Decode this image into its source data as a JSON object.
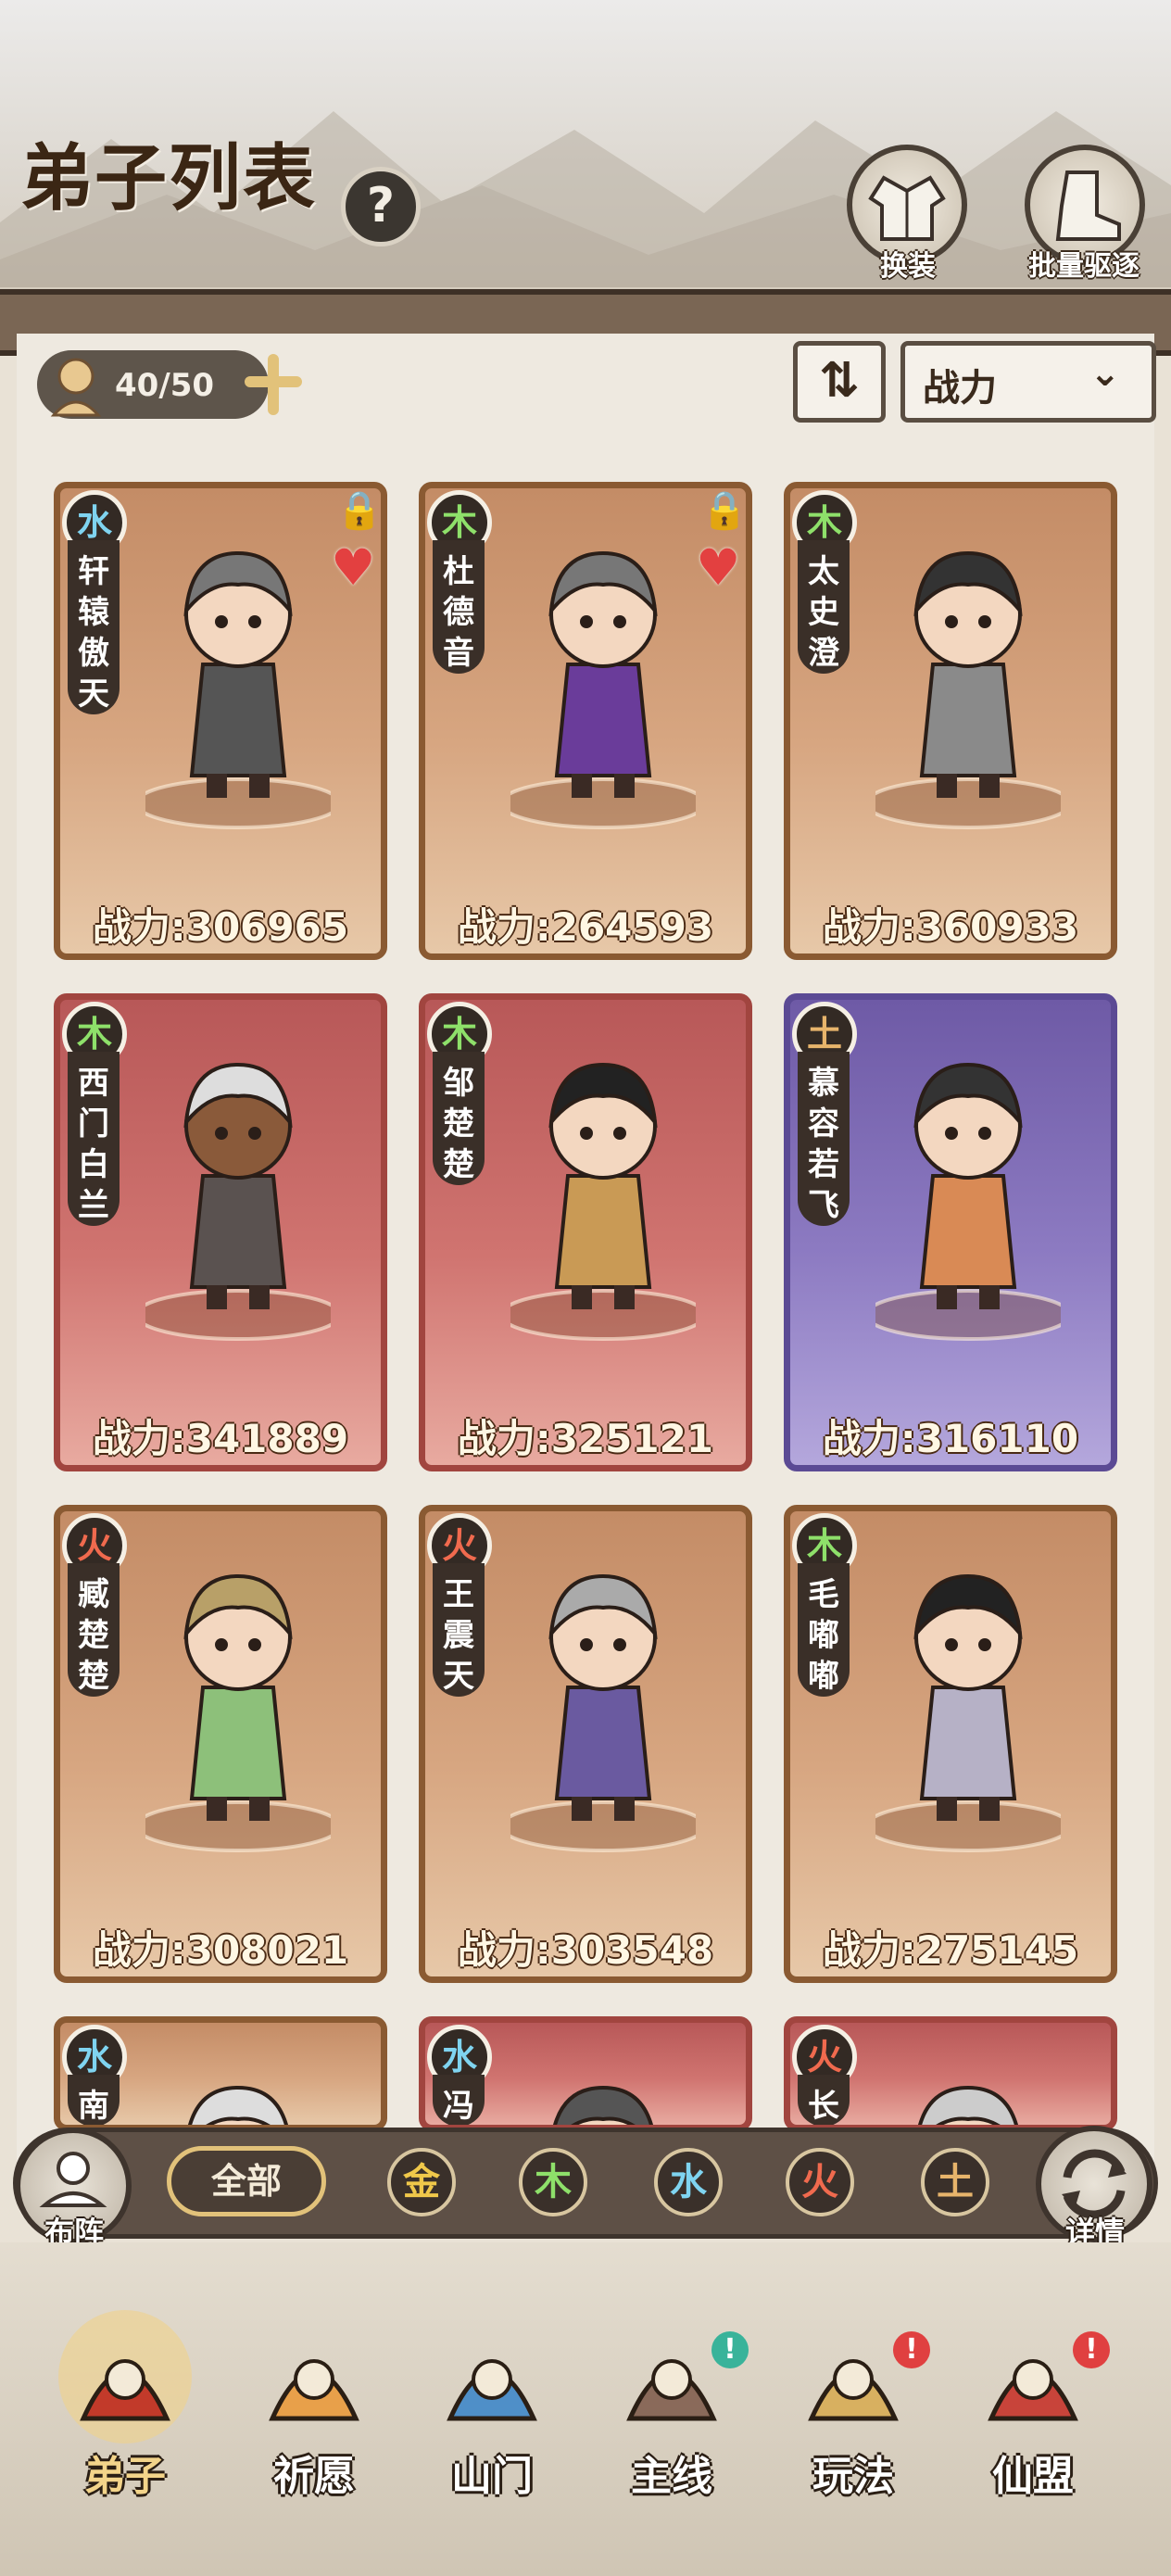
{
  "header": {
    "title": "弟子列表",
    "help_icon": "question-mark-icon",
    "help_glyph": "?",
    "buttons": [
      {
        "label": "换装",
        "icon": "robe-icon"
      },
      {
        "label": "批量驱逐",
        "icon": "boot-icon"
      }
    ]
  },
  "toolbar": {
    "capacity": "40/50",
    "sort_icon": "sort-arrows-icon",
    "sort_glyph": "⇅",
    "sort_by": "战力",
    "dropdown_glyph": "⌄"
  },
  "element_colors": {
    "水": "#7fd4f0",
    "木": "#8ee06a",
    "土": "#e7b46b",
    "火": "#f06a4e",
    "金": "#f0c84a"
  },
  "disciples": [
    {
      "name": "轩辕傲天",
      "element": "水",
      "power_text": "战力:306965",
      "power": 306965,
      "locked": true,
      "favorite": true,
      "style": "normal"
    },
    {
      "name": "杜德音",
      "element": "木",
      "power_text": "战力:264593",
      "power": 264593,
      "locked": true,
      "favorite": true,
      "style": "normal"
    },
    {
      "name": "太史澄",
      "element": "木",
      "power_text": "战力:360933",
      "power": 360933,
      "locked": false,
      "favorite": false,
      "style": "normal"
    },
    {
      "name": "西门白兰",
      "element": "木",
      "power_text": "战力:341889",
      "power": 341889,
      "locked": false,
      "favorite": false,
      "style": "red"
    },
    {
      "name": "邹楚楚",
      "element": "木",
      "power_text": "战力:325121",
      "power": 325121,
      "locked": false,
      "favorite": false,
      "style": "red"
    },
    {
      "name": "慕容若飞",
      "element": "土",
      "power_text": "战力:316110",
      "power": 316110,
      "locked": false,
      "favorite": false,
      "style": "purple"
    },
    {
      "name": "臧楚楚",
      "element": "火",
      "power_text": "战力:308021",
      "power": 308021,
      "locked": false,
      "favorite": false,
      "style": "normal"
    },
    {
      "name": "王震天",
      "element": "火",
      "power_text": "战力:303548",
      "power": 303548,
      "locked": false,
      "favorite": false,
      "style": "normal"
    },
    {
      "name": "毛嘟嘟",
      "element": "木",
      "power_text": "战力:275145",
      "power": 275145,
      "locked": false,
      "favorite": false,
      "style": "normal"
    },
    {
      "name": "南",
      "element": "水",
      "power_text": "",
      "locked": false,
      "favorite": false,
      "style": "normal"
    },
    {
      "name": "冯",
      "element": "水",
      "power_text": "",
      "locked": false,
      "favorite": false,
      "style": "red"
    },
    {
      "name": "长",
      "element": "火",
      "power_text": "",
      "locked": false,
      "favorite": false,
      "style": "red"
    }
  ],
  "filter": {
    "left_button": "布阵",
    "all": "全部",
    "elements": [
      "金",
      "木",
      "水",
      "火",
      "土"
    ],
    "right_button": "详情"
  },
  "bottom_nav": [
    {
      "label": "弟子",
      "icon": "disciple-portrait-icon",
      "active": true,
      "badge": false
    },
    {
      "label": "祈愿",
      "icon": "fire-scroll-icon",
      "active": false,
      "badge": false
    },
    {
      "label": "山门",
      "icon": "gate-icon",
      "active": false,
      "badge": false
    },
    {
      "label": "主线",
      "icon": "sword-stone-icon",
      "active": false,
      "badge": true
    },
    {
      "label": "玩法",
      "icon": "scroll-map-icon",
      "active": false,
      "badge": true
    },
    {
      "label": "仙盟",
      "icon": "alliance-banner-icon",
      "active": false,
      "badge": true
    }
  ],
  "badge_glyph": "!"
}
